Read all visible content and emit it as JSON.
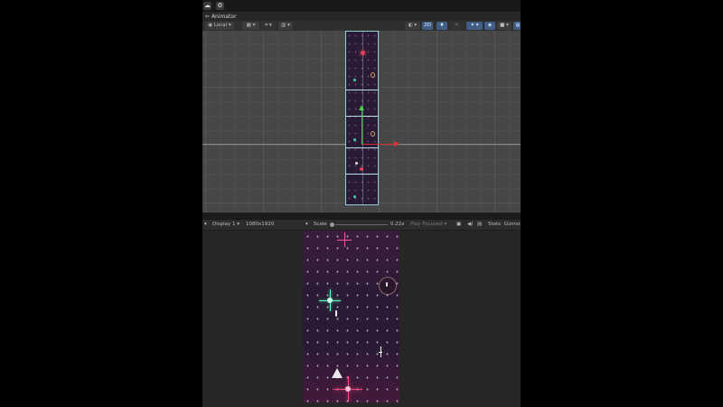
{
  "topbar": {
    "cloud_icon": "cloud-icon",
    "settings_icon": "gear-icon"
  },
  "tabs": [
    {
      "label": "Animator",
      "icon": "animator-icon"
    }
  ],
  "scene_toolbar": {
    "pivot_label": "Local",
    "buttons": [
      "grid-icon",
      "snap-icon",
      "increment-icon",
      "draw-mode-icon",
      "2D",
      "light-icon",
      "audio-icon",
      "fx-icon",
      "camera-icon",
      "gizmo-icon"
    ],
    "mode_2d": "2D"
  },
  "game_toolbar": {
    "display": "Display 1",
    "resolution": "1080x1920",
    "scale_label": "Scale",
    "scale_value": "0.22x",
    "play_mode": "Play Focused",
    "stats": "Stats",
    "gizmos": "Gizmos"
  },
  "colors": {
    "editor_bg": "#1b1b1b",
    "scene_grid": "#474747",
    "selection_outline": "#8fd0d6",
    "gizmo_y": "#48c04a",
    "gizmo_x": "#d03030",
    "game_bg": "#2a1a33"
  }
}
